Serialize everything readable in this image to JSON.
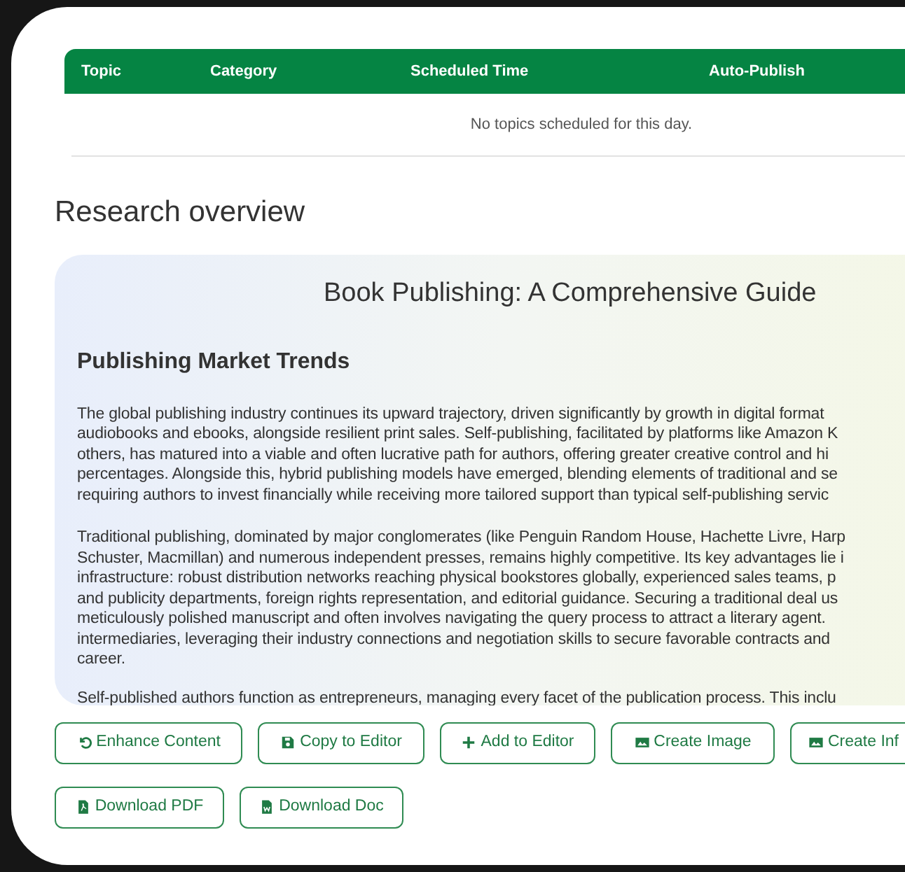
{
  "schedule_table": {
    "columns": [
      "Topic",
      "Category",
      "Scheduled Time",
      "Auto-Publish"
    ],
    "empty_message": "No topics scheduled for this day."
  },
  "section_title": "Research overview",
  "overview": {
    "title": "Book Publishing: A Comprehensive Guide",
    "heading": "Publishing Market Trends",
    "paragraphs": [
      "The global publishing industry continues its upward trajectory, driven significantly by growth in digital format\naudiobooks and ebooks, alongside resilient print sales. Self-publishing, facilitated by platforms like Amazon K\nothers, has matured into a viable and often lucrative path for authors, offering greater creative control and hi\npercentages. Alongside this, hybrid publishing models have emerged, blending elements of traditional and se\nrequiring authors to invest financially while receiving more tailored support than typical self-publishing servic",
      "Traditional publishing, dominated by major conglomerates (like Penguin Random House, Hachette Livre, Harp\nSchuster, Macmillan) and numerous independent presses, remains highly competitive. Its key advantages lie i\ninfrastructure: robust distribution networks reaching physical bookstores globally, experienced sales teams, p\nand publicity departments, foreign rights representation, and editorial guidance. Securing a traditional deal us\nmeticulously polished manuscript and often involves navigating the query process to attract a literary agent.\nintermediaries, leveraging their industry connections and negotiation skills to secure favorable contracts and\ncareer.",
      "Self-published authors function as entrepreneurs, managing every facet of the publication process. This inclu"
    ]
  },
  "actions": [
    {
      "label": "Enhance Content",
      "kind": "undo"
    },
    {
      "label": "Copy to Editor",
      "kind": "save"
    },
    {
      "label": "Add to Editor",
      "kind": "plus"
    },
    {
      "label": "Create Image",
      "kind": "image"
    },
    {
      "label": "Create Inf",
      "kind": "image"
    },
    {
      "label": "Download PDF",
      "kind": "pdf"
    },
    {
      "label": "Download Doc",
      "kind": "doc"
    }
  ]
}
